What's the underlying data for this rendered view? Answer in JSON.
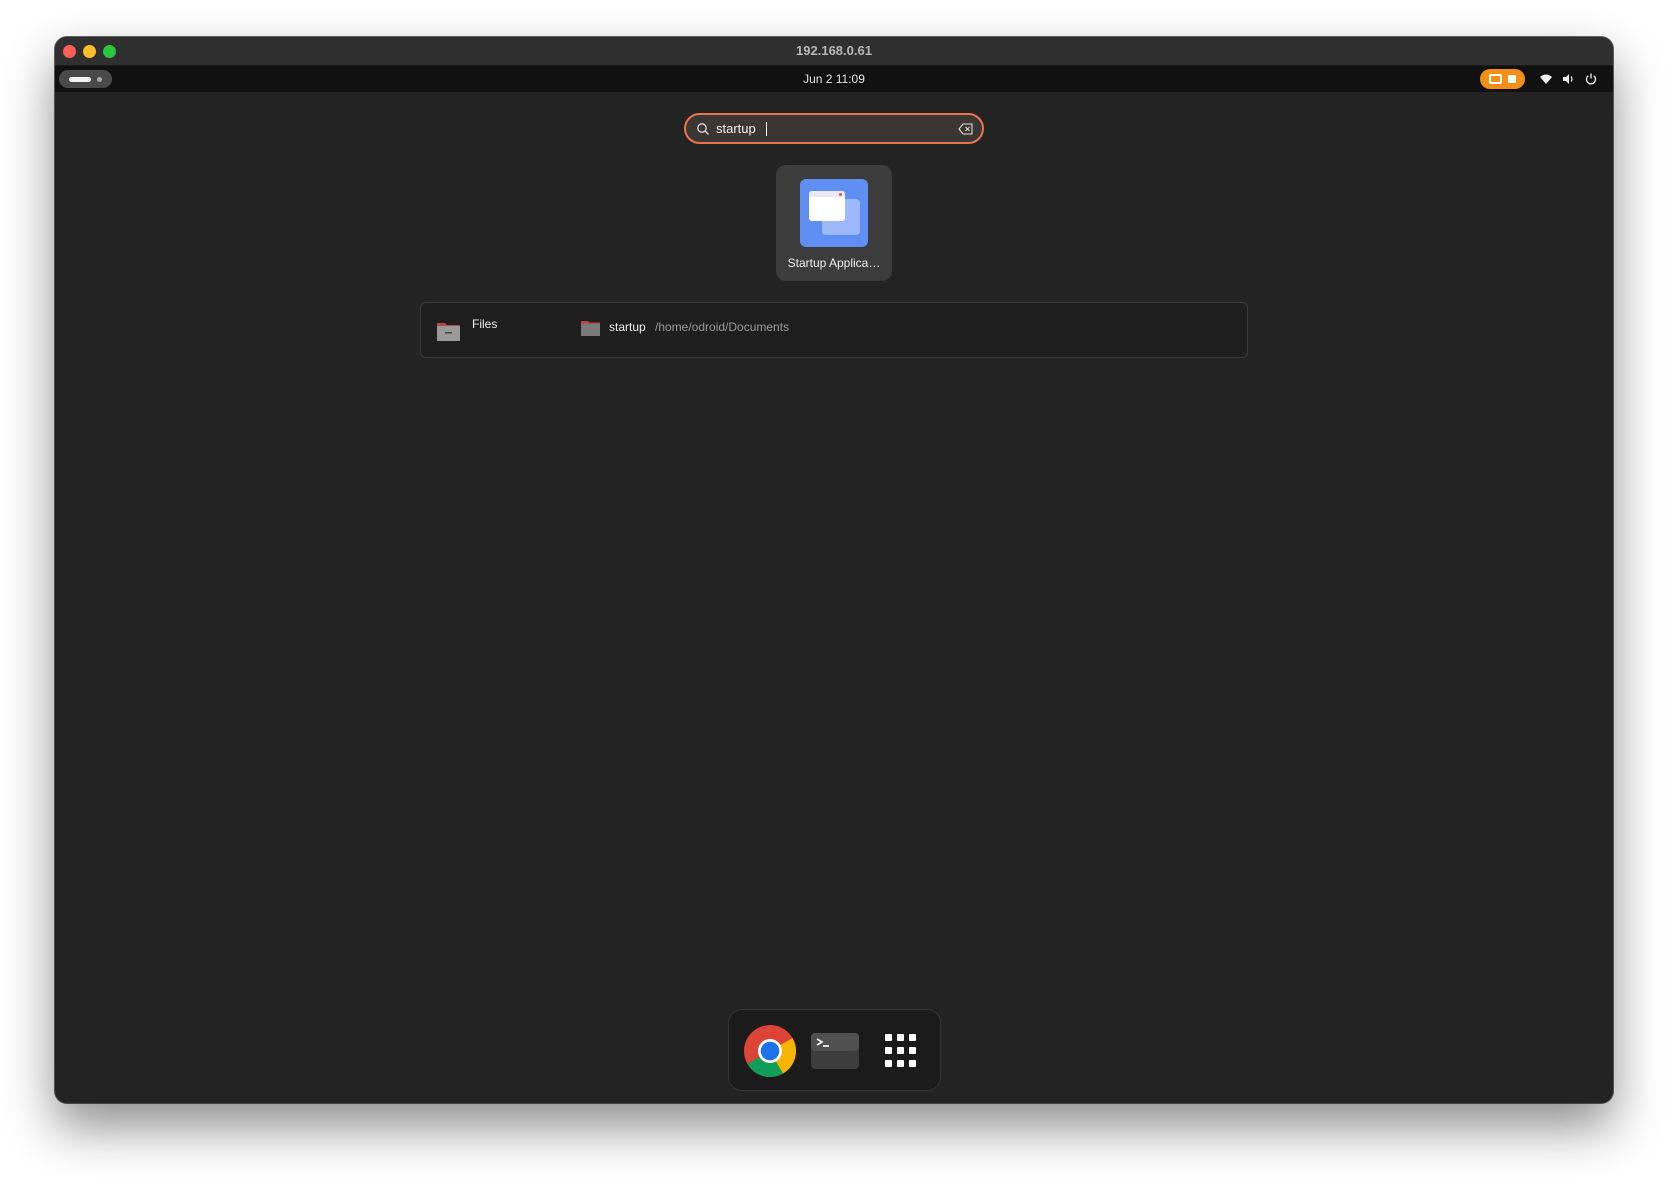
{
  "window": {
    "title": "192.168.0.61"
  },
  "topbar": {
    "datetime": "Jun 2  11:09"
  },
  "search": {
    "value": "startup",
    "placeholder": ""
  },
  "app_results": [
    {
      "label": "Startup Applica…",
      "icon": "startup-applications-icon"
    }
  ],
  "provider_results": {
    "provider": "Files",
    "items": [
      {
        "name": "startup",
        "path": "/home/odroid/Documents"
      }
    ]
  },
  "dock": [
    {
      "name": "chrome",
      "icon": "chrome-icon"
    },
    {
      "name": "terminal",
      "icon": "terminal-icon"
    },
    {
      "name": "show-apps",
      "icon": "app-grid-icon"
    }
  ],
  "colors": {
    "accent": "#e8754c",
    "recording": "#f38f16",
    "app_icon_blue": "#5f8ff3",
    "background": "#232323"
  }
}
